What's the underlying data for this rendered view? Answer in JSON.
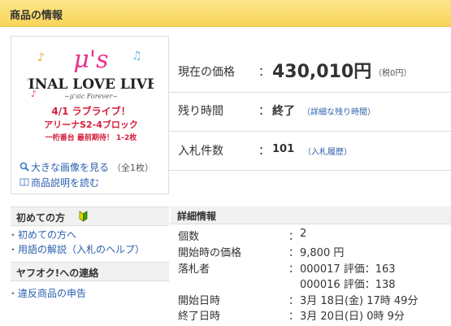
{
  "header": {
    "title": "商品の情報"
  },
  "image_panel": {
    "logo": {
      "line1": "μ's",
      "line2": "FINAL LOVE LIVE!",
      "line3": "~μ'sic Forever~",
      "line4": "4/1 ラブライブ！",
      "line5": "アリーナS2-4ブロック",
      "line6": "一桁番台 最前期待！ 1-2枚"
    },
    "view_large_label": "大きな画像を見る",
    "view_large_count": "（全1枚）",
    "read_description_label": "商品説明を読む"
  },
  "price_info": {
    "current_price": {
      "label": "現在の価格",
      "colon": "：",
      "value": "430,010円",
      "tax_note": "（税0円）"
    },
    "time_left": {
      "label": "残り時間",
      "colon": "：",
      "value": "終了",
      "link": "（詳細な残り時間）"
    },
    "bids": {
      "label": "入札件数",
      "colon": "：",
      "value": "101",
      "link": "（入札履歴）"
    }
  },
  "sidebar": {
    "first_time": {
      "heading": "初めての方",
      "links": [
        "初めての方へ",
        "用語の解説（入札のヘルプ）"
      ]
    },
    "contact": {
      "heading": "ヤフオク!への連絡",
      "links": [
        "違反商品の申告"
      ]
    }
  },
  "details": {
    "heading": "詳細情報",
    "colon": "：",
    "rows": [
      {
        "label": "個数",
        "value": "2"
      },
      {
        "label": "開始時の価格",
        "value": "9,800 円"
      },
      {
        "label": "落札者",
        "value": "000017 評価：163",
        "value2": "000016 評価：138"
      },
      {
        "label": "開始日時",
        "value": "3月 18日(金) 17時 49分"
      },
      {
        "label": "終了日時",
        "value": "3月 20日(日) 0時 9分"
      }
    ]
  },
  "colors": {
    "header_bg": "#f8d55a",
    "link": "#2b5fad",
    "logo_pink": "#e8318a",
    "logo_red": "#d21f3c"
  }
}
